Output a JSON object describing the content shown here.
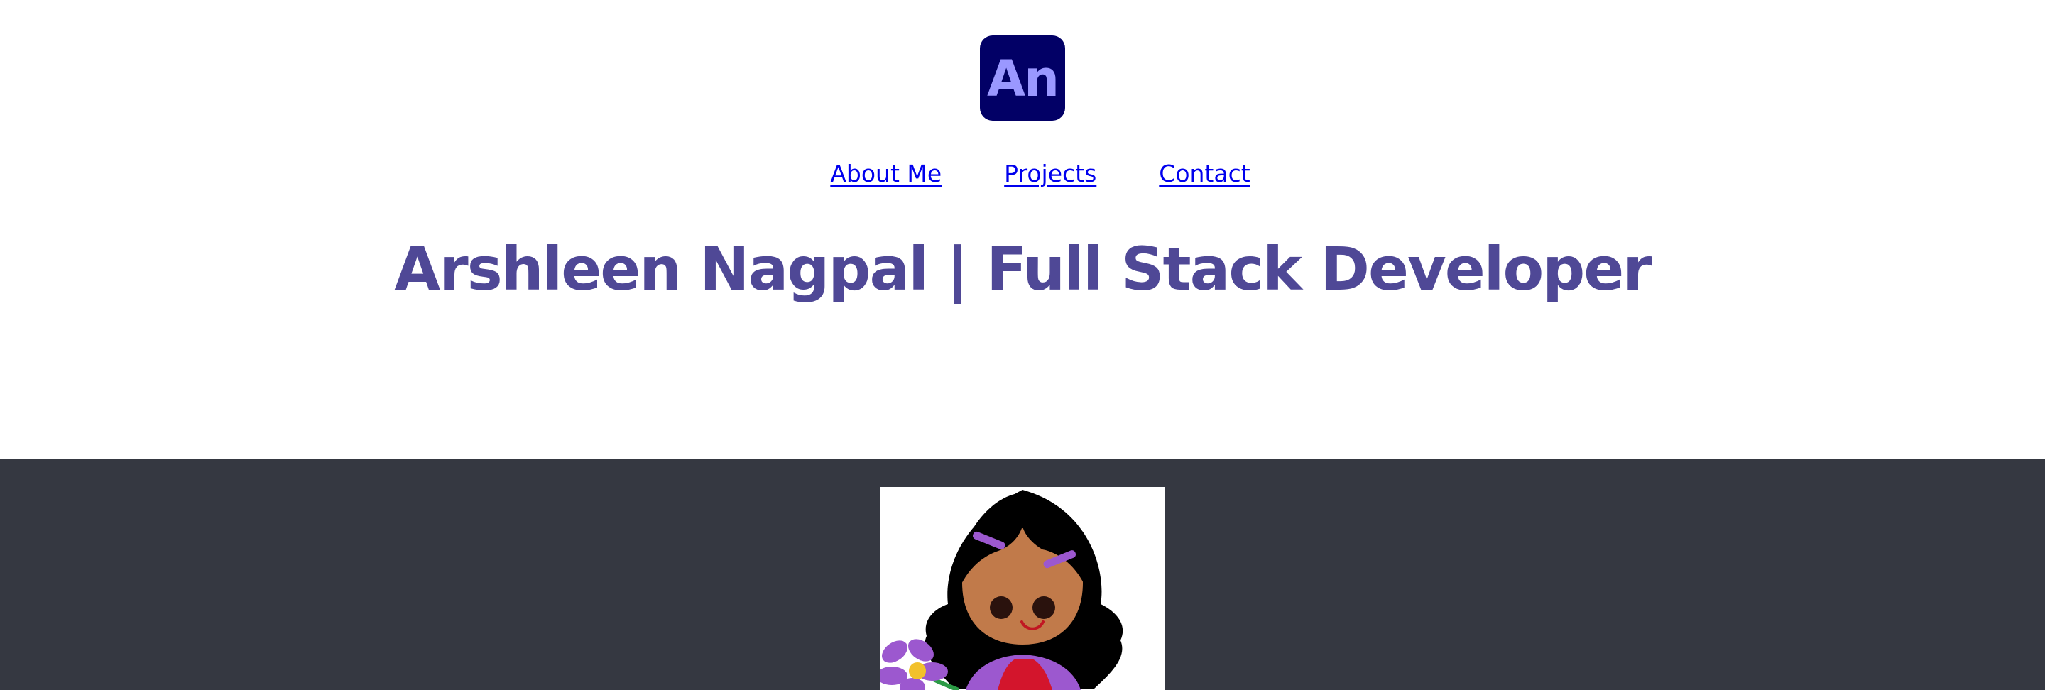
{
  "logo": {
    "text": "An",
    "background": "#020066",
    "text_color": "#9a98ff"
  },
  "nav": {
    "items": [
      {
        "label": "About Me"
      },
      {
        "label": "Projects"
      },
      {
        "label": "Contact"
      }
    ],
    "link_color": "#0000ee"
  },
  "header": {
    "title": "Arshleen Nagpal | Full Stack Developer",
    "title_color": "#4f4896"
  },
  "hero": {
    "background": "#353841",
    "avatar_icon": "girl-with-flower-illustration"
  }
}
